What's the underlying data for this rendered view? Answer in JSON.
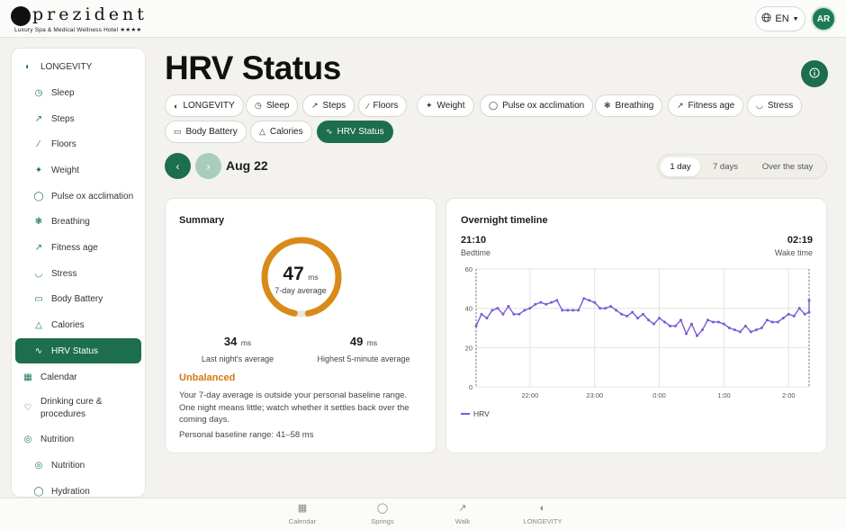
{
  "brand": {
    "name": "prezident",
    "tagline": "Luxury Spa & Medical Wellness Hotel ★★★★"
  },
  "header": {
    "language": "EN",
    "avatar_initials": "AR"
  },
  "sidebar": {
    "items": [
      {
        "label": "LONGEVITY",
        "icon": "longevity-icon"
      },
      {
        "label": "Sleep",
        "icon": "clock-icon"
      },
      {
        "label": "Steps",
        "icon": "walk-icon"
      },
      {
        "label": "Floors",
        "icon": "stairs-icon"
      },
      {
        "label": "Weight",
        "icon": "weight-icon"
      },
      {
        "label": "Pulse ox acclimation",
        "icon": "droplet-icon"
      },
      {
        "label": "Breathing",
        "icon": "lungs-icon"
      },
      {
        "label": "Fitness age",
        "icon": "run-icon"
      },
      {
        "label": "Stress",
        "icon": "gauge-icon"
      },
      {
        "label": "Body Battery",
        "icon": "battery-icon"
      },
      {
        "label": "Calories",
        "icon": "flame-icon"
      },
      {
        "label": "HRV Status",
        "icon": "pulse-icon"
      },
      {
        "label": "Calendar",
        "icon": "calendar-icon"
      },
      {
        "label": "Drinking cure & procedures",
        "icon": "heart-icon"
      },
      {
        "label": "Nutrition",
        "icon": "target-icon"
      },
      {
        "label": "Nutrition",
        "icon": "target-icon"
      },
      {
        "label": "Hydration",
        "icon": "droplet-icon"
      }
    ]
  },
  "page": {
    "title": "HRV Status"
  },
  "chips": [
    {
      "label": "LONGEVITY",
      "icon": "longevity-icon"
    },
    {
      "label": "Sleep",
      "icon": "clock-icon"
    },
    {
      "label": "Steps",
      "icon": "walk-icon"
    },
    {
      "label": "Floors",
      "icon": "stairs-icon"
    },
    {
      "label": "Weight",
      "icon": "weight-icon"
    },
    {
      "label": "Pulse ox acclimation",
      "icon": "droplet-icon"
    },
    {
      "label": "Breathing",
      "icon": "lungs-icon"
    },
    {
      "label": "Fitness age",
      "icon": "run-icon"
    },
    {
      "label": "Stress",
      "icon": "gauge-icon"
    },
    {
      "label": "Body Battery",
      "icon": "battery-icon"
    },
    {
      "label": "Calories",
      "icon": "flame-icon"
    },
    {
      "label": "HRV Status",
      "icon": "pulse-icon"
    }
  ],
  "date_nav": {
    "date": "Aug 22"
  },
  "range": {
    "options": [
      "1 day",
      "7 days",
      "Over the stay"
    ],
    "selected": "1 day"
  },
  "summary": {
    "title": "Summary",
    "ring_value": "47",
    "ring_unit": "ms",
    "ring_caption": "7-day average",
    "ring_fill_fraction": 0.94,
    "last_night_value": "34",
    "last_night_unit": "ms",
    "last_night_label": "Last night's average",
    "highest_value": "49",
    "highest_unit": "ms",
    "highest_label": "Highest 5-minute average",
    "status": "Unbalanced",
    "description": "Your 7-day average is outside your personal baseline range. One night means little; watch whether it settles back over the coming days.",
    "baseline": "Personal baseline range: 41–58 ms"
  },
  "timeline": {
    "title": "Overnight timeline",
    "bedtime_value": "21:10",
    "bedtime_label": "Bedtime",
    "wake_value": "02:19",
    "wake_label": "Wake time"
  },
  "colors": {
    "brand_green": "#1d6e4e",
    "ring_orange": "#d98a18",
    "status_orange": "#d17a10",
    "line_purple": "#7b5bd6"
  },
  "chart_data": {
    "type": "line",
    "title": "",
    "xlabel": "",
    "ylabel": "",
    "x_range": [
      "21:10",
      "02:19"
    ],
    "x_ticks": [
      "22:00",
      "23:00",
      "0:00",
      "1:00",
      "2:00"
    ],
    "y_ticks": [
      "0",
      "20",
      "40",
      "60"
    ],
    "ylim": [
      0,
      60
    ],
    "grid": true,
    "legend": "bottom-left",
    "series": [
      {
        "name": "HRV",
        "x": [
          "21:10",
          "21:15",
          "21:20",
          "21:25",
          "21:30",
          "21:35",
          "21:40",
          "21:45",
          "21:50",
          "21:55",
          "22:00",
          "22:05",
          "22:10",
          "22:15",
          "22:20",
          "22:25",
          "22:30",
          "22:35",
          "22:40",
          "22:45",
          "22:50",
          "22:55",
          "23:00",
          "23:05",
          "23:10",
          "23:15",
          "23:20",
          "23:25",
          "23:30",
          "23:35",
          "23:40",
          "23:45",
          "23:50",
          "23:55",
          "0:00",
          "0:05",
          "0:10",
          "0:15",
          "0:20",
          "0:25",
          "0:30",
          "0:35",
          "0:40",
          "0:45",
          "0:50",
          "0:55",
          "1:00",
          "1:05",
          "1:10",
          "1:15",
          "1:20",
          "1:25",
          "1:30",
          "1:35",
          "1:40",
          "1:45",
          "1:50",
          "1:55",
          "2:00",
          "2:05",
          "2:10",
          "2:15",
          "2:19"
        ],
        "values": [
          31,
          37,
          35,
          39,
          40,
          37,
          41,
          37,
          37,
          39,
          40,
          42,
          43,
          42,
          43,
          44,
          39,
          39,
          39,
          39,
          45,
          44,
          43,
          40,
          40,
          41,
          39,
          37,
          36,
          38,
          35,
          37,
          34,
          32,
          35,
          33,
          31,
          31,
          34,
          27,
          32,
          26,
          29,
          34,
          33,
          33,
          32,
          30,
          29,
          28,
          31,
          28,
          29,
          30,
          34,
          33,
          33,
          35,
          37,
          36,
          40,
          37,
          38
        ],
        "extra_end_value": 44
      }
    ]
  },
  "bottom_tabs": [
    {
      "label": "Calendar",
      "icon": "calendar-icon"
    },
    {
      "label": "Springs",
      "icon": "droplet-icon"
    },
    {
      "label": "Walk",
      "icon": "walk-icon"
    },
    {
      "label": "LONGEVITY",
      "icon": "longevity-icon"
    }
  ]
}
